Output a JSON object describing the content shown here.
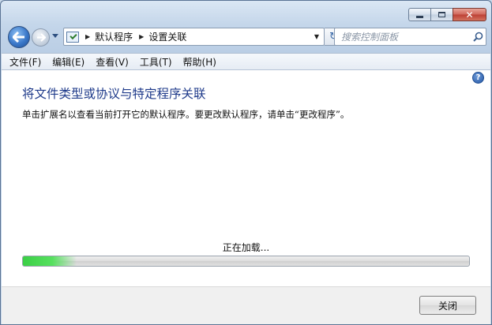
{
  "window": {
    "minimize_icon": "minimize-icon",
    "maximize_icon": "maximize-icon",
    "close_icon": "close-icon",
    "close_glyph": "✕"
  },
  "nav": {
    "back_icon": "back-arrow-icon",
    "forward_icon": "forward-arrow-icon",
    "breadcrumb": [
      "默认程序",
      "设置关联"
    ],
    "refresh_glyph": "↻",
    "search_placeholder": "搜索控制面板"
  },
  "menu": [
    "文件(F)",
    "编辑(E)",
    "查看(V)",
    "工具(T)",
    "帮助(H)"
  ],
  "content": {
    "title": "将文件类型或协议与特定程序关联",
    "description": "单击扩展名以查看当前打开它的默认程序。要更改默认程序，请单击“更改程序”。",
    "help_glyph": "?",
    "loading_text": "正在加载...",
    "progress": 0.12
  },
  "footer": {
    "close_button": "关闭"
  },
  "colors": {
    "title": "#1e3a8a",
    "progress_green": "#3bcf46",
    "close_red": "#bc3f33"
  }
}
